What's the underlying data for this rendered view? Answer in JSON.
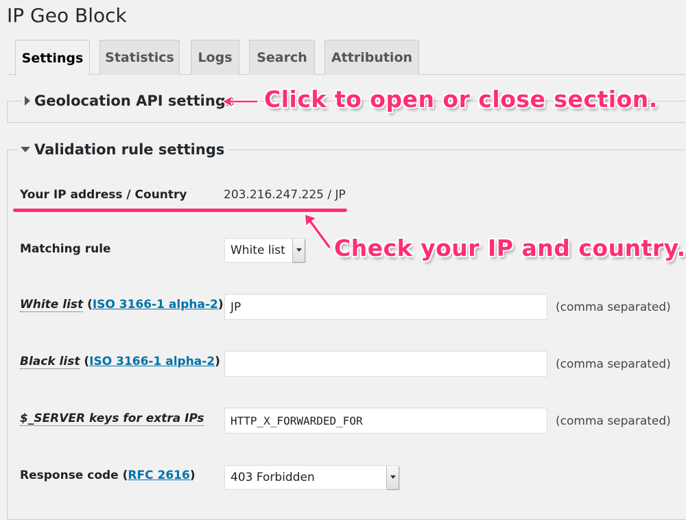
{
  "title": "IP Geo Block",
  "tabs": [
    "Settings",
    "Statistics",
    "Logs",
    "Search",
    "Attribution"
  ],
  "active_tab": "Settings",
  "sections": {
    "geolocation": {
      "label": "Geolocation API settings",
      "state": "collapsed"
    },
    "validation": {
      "label": "Validation rule settings",
      "state": "expanded"
    }
  },
  "fields": {
    "ip": {
      "label": "Your IP address / Country",
      "value": "203.216.247.225 / JP"
    },
    "matching": {
      "label": "Matching rule",
      "value": "White list"
    },
    "white": {
      "label": "White list",
      "paren_open": " (",
      "link": "ISO 3166-1 alpha-2",
      "paren_close": ")",
      "value": "JP",
      "note": "(comma separated)"
    },
    "black": {
      "label": "Black list",
      "paren_open": " (",
      "link": "ISO 3166-1 alpha-2",
      "paren_close": ")",
      "value": "",
      "note": "(comma separated)"
    },
    "server": {
      "label": "$_SERVER keys for extra IPs",
      "value": "HTTP_X_FORWARDED_FOR",
      "note": "(comma separated)"
    },
    "response": {
      "label": "Response code",
      "paren_open": " (",
      "link": "RFC 2616",
      "paren_close": ")",
      "value": "403 Forbidden"
    }
  },
  "annotations": {
    "section_tip": "Click to open or close section.",
    "ip_tip": "Check your IP and country.",
    "color": "#ff2d78"
  }
}
